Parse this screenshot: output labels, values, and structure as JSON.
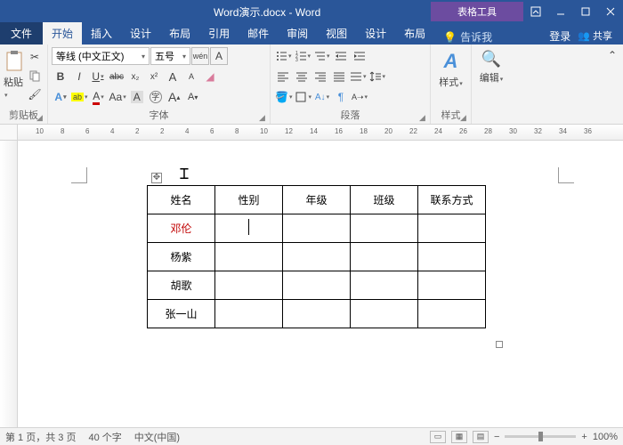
{
  "titlebar": {
    "title": "Word演示.docx - Word",
    "tabletools": "表格工具"
  },
  "tabs": {
    "file": "文件",
    "home": "开始",
    "insert": "插入",
    "design": "设计",
    "layout": "布局",
    "references": "引用",
    "mail": "邮件",
    "review": "审阅",
    "view": "视图",
    "tbldesign": "设计",
    "tbllayout": "布局",
    "tellme": "告诉我",
    "login": "登录",
    "share": "共享"
  },
  "ribbon": {
    "clipboard": {
      "label": "剪贴板",
      "paste": "粘贴"
    },
    "font": {
      "label": "字体",
      "name": "等线 (中文正文)",
      "size": "五号",
      "bold": "B",
      "italic": "I",
      "underline": "U",
      "strike": "abc",
      "sub": "x₂",
      "sup": "x²",
      "phonetic": "wén",
      "charborder": "A",
      "texteffects": "A",
      "highlight": "ab",
      "fontcolor": "A",
      "charshade": "A",
      "enclose": "字",
      "grow": "A",
      "shrink": "A",
      "clearfmt": "Aa"
    },
    "paragraph": {
      "label": "段落"
    },
    "styles": {
      "label": "样式",
      "btn": "样式"
    },
    "editing": {
      "label": "编辑"
    }
  },
  "ruler_ticks": [
    -10,
    -8,
    -6,
    -4,
    -2,
    2,
    4,
    6,
    8,
    10,
    12,
    14,
    16,
    18,
    20,
    22,
    24,
    26,
    28,
    30,
    32,
    34,
    36
  ],
  "table": {
    "headers": [
      "姓名",
      "性别",
      "年级",
      "班级",
      "联系方式"
    ],
    "rows": [
      [
        "邓伦",
        "",
        "",
        "",
        ""
      ],
      [
        "杨紫",
        "",
        "",
        "",
        ""
      ],
      [
        "胡歌",
        "",
        "",
        "",
        ""
      ],
      [
        "张一山",
        "",
        "",
        "",
        ""
      ]
    ],
    "red_row": 0
  },
  "status": {
    "page": "第 1 页，共 3 页",
    "words": "40 个字",
    "lang": "中文(中国)",
    "zoom": "100%"
  }
}
